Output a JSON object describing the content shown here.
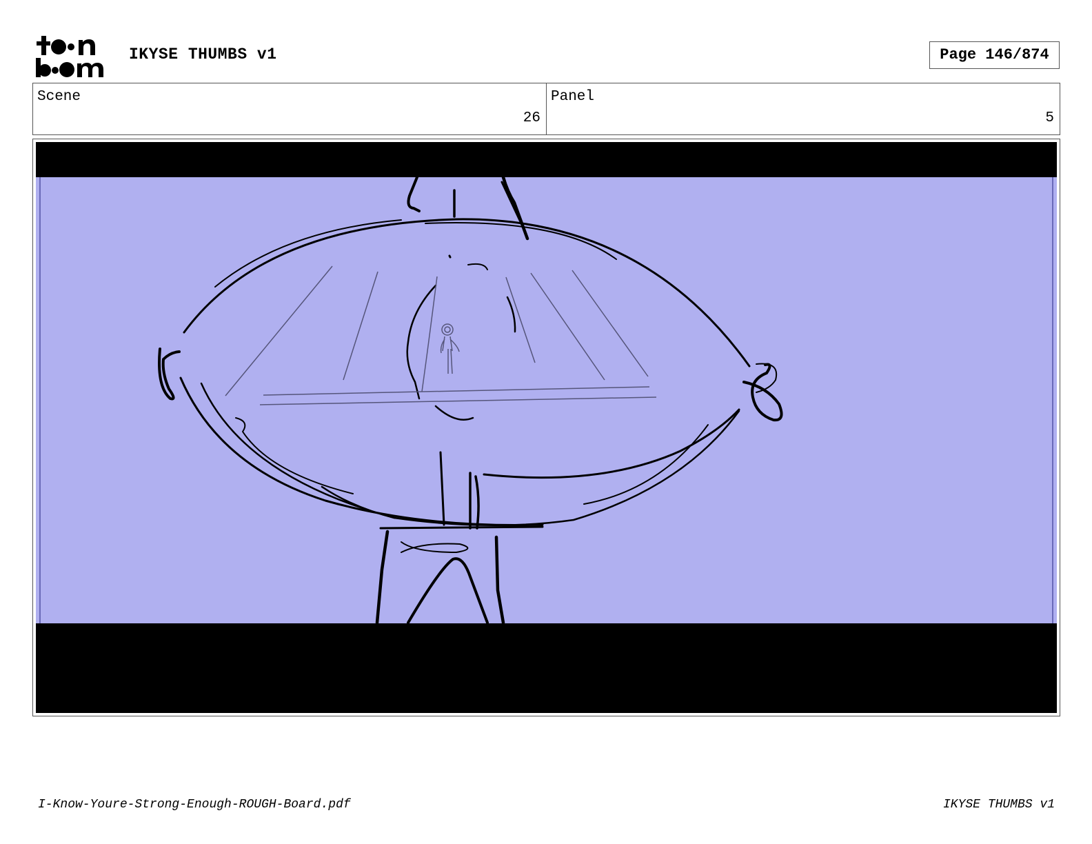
{
  "header": {
    "logo_name": "toon-boom-logo",
    "logo_text": "toon boom",
    "title": "IKYSE THUMBS v1",
    "page_indicator": "Page 146/874"
  },
  "info": {
    "scene_label": "Scene",
    "scene_value": "26",
    "panel_label": "Panel",
    "panel_value": "5"
  },
  "panel_image": {
    "background_color": "#b0b0f0",
    "letterbox_color": "#000000",
    "line_color": "#000000"
  },
  "footer": {
    "filename": "I-Know-Youre-Strong-Enough-ROUGH-Board.pdf",
    "project": "IKYSE THUMBS v1"
  }
}
